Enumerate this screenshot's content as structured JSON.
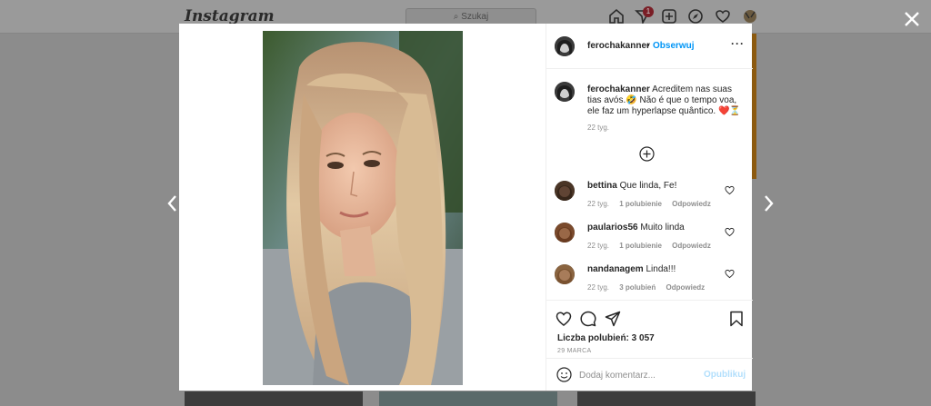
{
  "background": {
    "logo": "Instagram",
    "search_placeholder": "Szukaj",
    "notification_count": "1"
  },
  "modal": {
    "header": {
      "username": "ferochakanner",
      "separator": "•",
      "follow_label": "Obserwuj",
      "more_label": "···"
    },
    "caption": {
      "username": "ferochakanner",
      "text": "Acreditem nas suas tias avós.🤣 Não é que o tempo voa, ele faz um hyperlapse quântico. ❤️⏳",
      "time": "22 tyg."
    },
    "comments": [
      {
        "username": "bettina",
        "text": "Que linda, Fe!",
        "time": "22 tyg.",
        "likes": "1 polubienie",
        "reply": "Odpowiedz"
      },
      {
        "username": "paularios56",
        "text": "Muito linda",
        "time": "22 tyg.",
        "likes": "1 polubienie",
        "reply": "Odpowiedz"
      },
      {
        "username": "nandanagem",
        "text": "Linda!!!",
        "time": "22 tyg.",
        "likes": "3 polubień",
        "reply": "Odpowiedz"
      }
    ],
    "likes_text": "Liczba polubień: 3 057",
    "date": "29 MARCA",
    "comment_placeholder": "Dodaj komentarz...",
    "publish_label": "Opublikuj"
  },
  "icons": {
    "close": "close-icon",
    "prev": "chevron-left-icon",
    "next": "chevron-right-icon",
    "like": "heart-icon",
    "comment": "comment-icon",
    "share": "share-icon",
    "save": "bookmark-icon",
    "emoji": "emoji-icon",
    "load_more": "plus-circle-icon"
  },
  "colors": {
    "link": "#0095f6",
    "publish_disabled": "#b2dffc",
    "muted": "#8e8e8e",
    "text": "#262626"
  }
}
